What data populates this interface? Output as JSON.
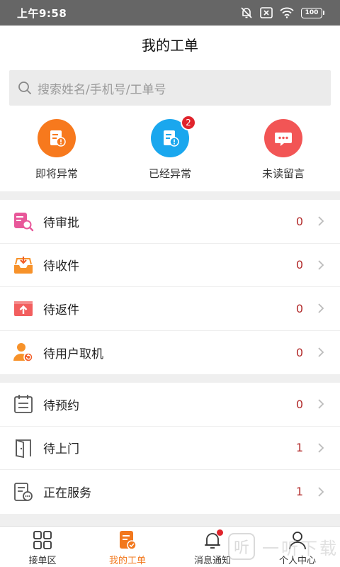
{
  "status_bar": {
    "time": "上午9:58",
    "battery": "100"
  },
  "header": {
    "title": "我的工单"
  },
  "search": {
    "placeholder": "搜索姓名/手机号/工单号"
  },
  "quick_actions": [
    {
      "label": "即将异常",
      "icon": "work-order-warning-icon",
      "color": "#f7791d",
      "badge": ""
    },
    {
      "label": "已经异常",
      "icon": "work-order-warning-icon",
      "color": "#1aa7ee",
      "badge": "2"
    },
    {
      "label": "未读留言",
      "icon": "message-bubble-icon",
      "color": "#f25555",
      "badge": ""
    }
  ],
  "group_1": [
    {
      "label": "待审批",
      "count": "0",
      "icon": "review-search-icon",
      "color": "#e8589a"
    },
    {
      "label": "待收件",
      "count": "0",
      "icon": "inbox-download-icon",
      "color": "#f7922a"
    },
    {
      "label": "待返件",
      "count": "0",
      "icon": "box-upload-icon",
      "color": "#f25e5e"
    },
    {
      "label": "待用户取机",
      "count": "0",
      "icon": "user-return-icon",
      "color": "#f7922a"
    }
  ],
  "group_2": [
    {
      "label": "待预约",
      "count": "0",
      "icon": "calendar-icon",
      "color": "#555555"
    },
    {
      "label": "待上门",
      "count": "1",
      "icon": "door-icon",
      "color": "#555555"
    },
    {
      "label": "正在服务",
      "count": "1",
      "icon": "service-doc-icon",
      "color": "#555555"
    }
  ],
  "tabs": [
    {
      "label": "接单区",
      "icon": "grid-icon"
    },
    {
      "label": "我的工单",
      "icon": "work-order-check-icon"
    },
    {
      "label": "消息通知",
      "icon": "bell-icon"
    },
    {
      "label": "个人中心",
      "icon": "person-icon"
    }
  ],
  "watermark": {
    "logo": "听",
    "text": "一听下载"
  },
  "colors": {
    "accent": "#f2781d",
    "count": "#b22a2a",
    "badge": "#e0242c"
  }
}
